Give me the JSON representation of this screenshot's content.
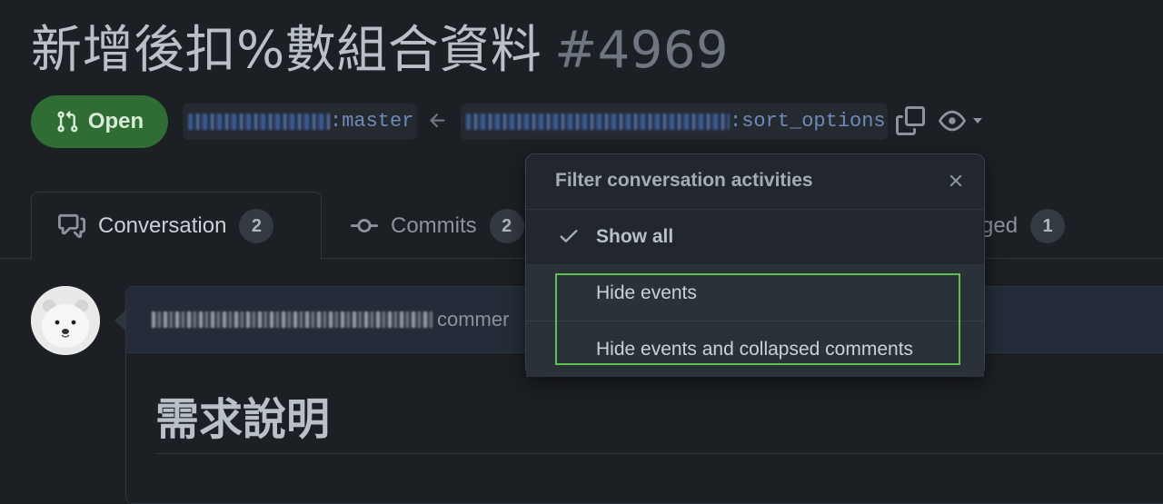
{
  "pr": {
    "title": "新增後扣%數組合資料",
    "number": "#4969",
    "state": "Open",
    "base_branch_suffix": ":master",
    "head_branch_suffix": ":sort_options"
  },
  "tabs": [
    {
      "label": "Conversation",
      "count": "2"
    },
    {
      "label": "Commits",
      "count": "2"
    },
    {
      "label": "ged",
      "count": "1"
    }
  ],
  "comment": {
    "action": "commer",
    "heading": "需求說明"
  },
  "filter_menu": {
    "title": "Filter conversation activities",
    "items": [
      {
        "label": "Show all",
        "selected": true
      },
      {
        "label": "Hide events",
        "selected": false
      },
      {
        "label": "Hide events and collapsed comments",
        "selected": false
      }
    ]
  },
  "colors": {
    "open_badge": "#2f6d34",
    "highlight_box": "#5fc24a",
    "branch_text": "#6e8ab8"
  },
  "icons": [
    "git-pull-request-icon",
    "arrow-left-icon",
    "copy-icon",
    "eye-icon",
    "caret-down-icon",
    "comment-discussion-icon",
    "git-commit-icon",
    "check-icon",
    "close-icon"
  ]
}
